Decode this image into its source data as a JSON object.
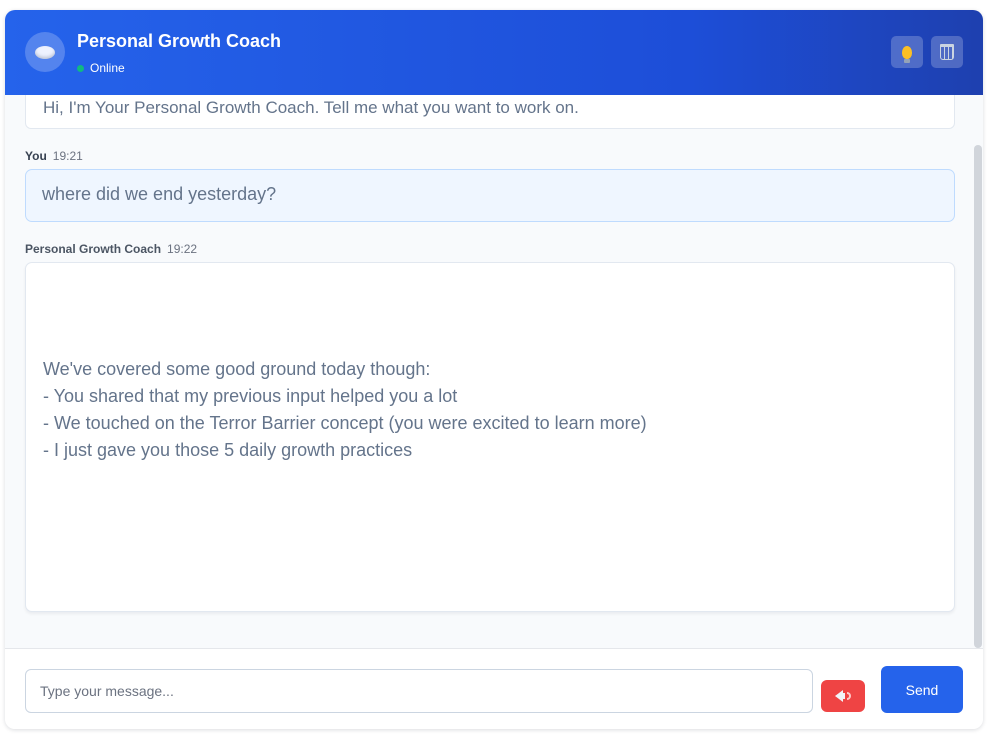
{
  "header": {
    "title": "Personal Growth Coach",
    "status": "Online",
    "avatar_icon": "speech-bubble-icon",
    "tips_icon": "lightbulb-icon",
    "clear_icon": "wastebasket-icon"
  },
  "messages": {
    "first_partial": "Hi, I'm Your Personal Growth Coach. Tell me what you want to work on.",
    "user": {
      "sender": "You",
      "time": "19:21",
      "text": "where did we end yesterday?"
    },
    "coach": {
      "sender": "Personal Growth Coach",
      "time": "19:22",
      "lines": [
        "We've covered some good ground today though:",
        "- You shared that my previous input helped you a lot",
        "- We touched on the Terror Barrier concept (you were excited to learn more)",
        "- I just gave you those 5 daily growth practices"
      ]
    }
  },
  "composer": {
    "placeholder": "Type your message...",
    "voice_icon": "speaker-icon",
    "send_label": "Send"
  },
  "colors": {
    "header_start": "#2563eb",
    "header_end": "#1e40af",
    "send": "#2563eb",
    "voice": "#ef4444",
    "online": "#10b981"
  }
}
